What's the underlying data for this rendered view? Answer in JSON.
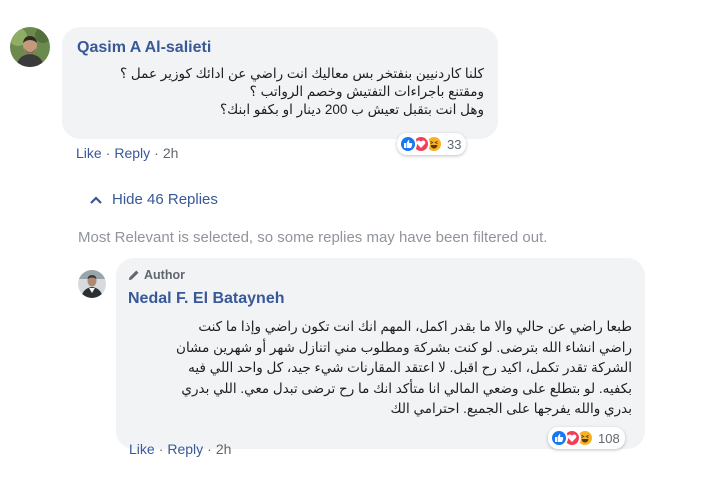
{
  "comment": {
    "author": "Qasim A Al-salieti",
    "lines": [
      "كلنا كاردنيين بنفتخر بس معاليك انت راضي عن ادائك كوزير عمل ؟",
      "ومقتنع باجراءات التفتيش وخصم الرواتب ؟",
      "وهل انت بتقبل تعيش ب 200 دينار او بكفو ابنك؟"
    ],
    "reaction_count": "33",
    "actions": {
      "like": "Like",
      "reply": "Reply",
      "time": "2h",
      "separator": "·"
    }
  },
  "replies": {
    "toggle_label": "Hide 46 Replies",
    "filter_note": "Most Relevant is selected, so some replies may have been filtered out."
  },
  "reply": {
    "badge": "Author",
    "author": "Nedal F. El Batayneh",
    "lines": [
      "طبعا راضي عن حالي والا ما بقدر اكمل، المهم انك انت تكون راضي وإذا ما كنت",
      "راضي انشاء الله بترضى. لو كنت بشركة ومطلوب مني اتنازل شهر أو شهرين مشان",
      "الشركة تقدر تكمل، اكيد رح اقبل. لا اعتقد المقارنات شيء جيد، كل واحد اللي فيه",
      "بكفيه. لو بتطلع على وضعي المالي انا متأكد انك ما رح ترضى تبدل معي. اللي بدري",
      "بدري والله يفرجها على الجميع. احترامي الك"
    ],
    "reaction_count": "108",
    "actions": {
      "like": "Like",
      "reply": "Reply",
      "time": "2h",
      "separator": "·"
    }
  },
  "colors": {
    "link": "#385898",
    "bubble": "#f2f3f5",
    "muted": "#90949c",
    "like": "#1877f2",
    "love": "#f33e58",
    "haha": "#f7b125"
  },
  "icons": [
    "profile-avatar",
    "like-reaction-icon",
    "love-reaction-icon",
    "haha-reaction-icon",
    "chevron-up-icon",
    "pencil-icon"
  ]
}
